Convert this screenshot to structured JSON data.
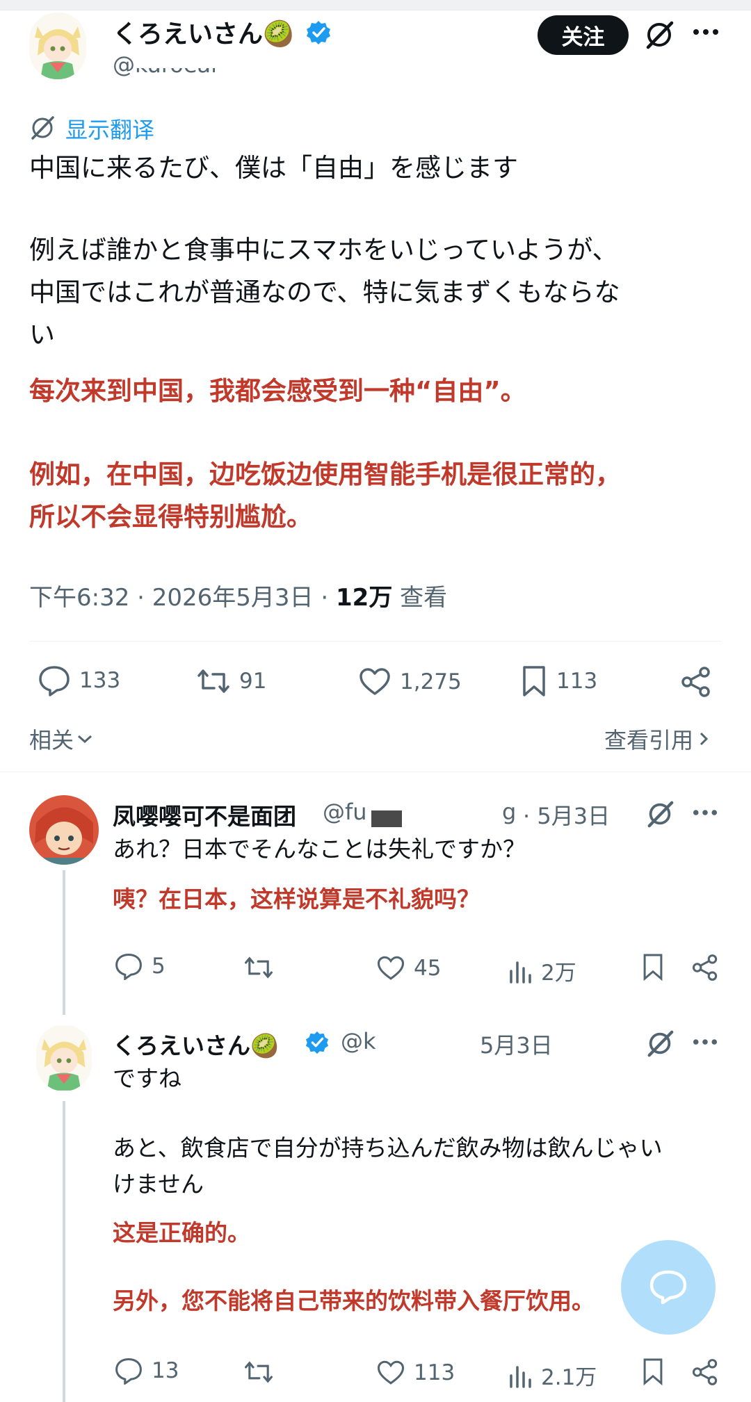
{
  "main_tweet": {
    "author_name": "くろえいさん🥝",
    "handle": "@kuroeai",
    "follow_label": "关注",
    "translate_label": "显示翻译",
    "text_ja_1": "中国に来るたび、僕は「自由」を感じます",
    "text_ja_2": "例えば誰かと食事中にスマホをいじっていようが、",
    "text_ja_3": "中国ではこれが普通なので、特に気まずくもならな",
    "text_ja_4": "い",
    "text_zh_1": "每次来到中国，我都会感受到一种“自由”。",
    "text_zh_2": "例如，在中国，边吃饭边使用智能手机是很正常的，",
    "text_zh_3": "所以不会显得特别尴尬。",
    "time": "下午6:32 · 2026年5月3日 · ",
    "views": "12万",
    "views_label": " 查看",
    "replies": "133",
    "retweets": "91",
    "likes": "1,275",
    "bookmarks": "113",
    "related_label": "相关",
    "quotes_label": "查看引用"
  },
  "reply1": {
    "author_name": "凤嘤嘤可不是面团",
    "handle": "@fu",
    "handle_tail": "g",
    "date": "· 5月3日",
    "text_ja": "あれ？日本でそんなことは失礼ですか？",
    "text_zh": "咦？在日本，这样说算是不礼貌吗？",
    "replies": "5",
    "likes": "45",
    "views": "2万"
  },
  "reply2": {
    "author_name": "くろえいさん🥝",
    "handle": "@k",
    "date": "5月3日",
    "text_ja_1": "ですね",
    "text_ja_2": "あと、飲食店で自分が持ち込んだ飲み物は飲んじゃい",
    "text_ja_3": "けません",
    "text_zh_1": "这是正确的。",
    "text_zh_2": "另外，您不能将自己带来的饮料带入餐厅饮用。",
    "replies": "13",
    "likes": "113",
    "views": "2.1万"
  },
  "colors": {
    "accent": "#1d9bf0",
    "translation_red": "#c0392b",
    "text": "#0f1419",
    "muted": "#536471"
  }
}
